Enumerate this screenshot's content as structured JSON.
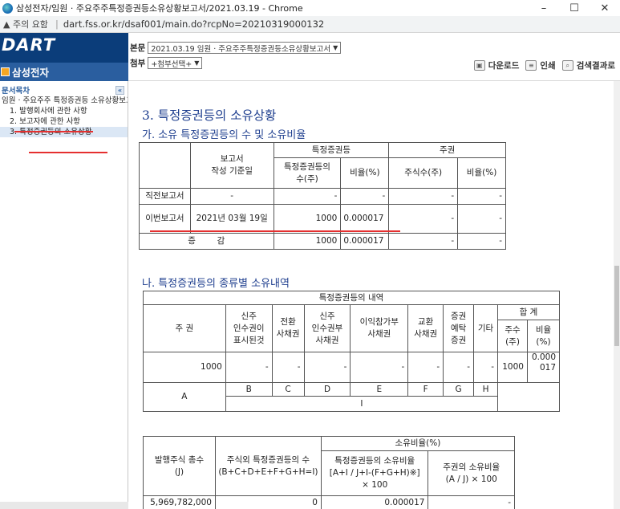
{
  "window": {
    "title": "삼성전자/임원 · 주요주주특정증권등소유상황보고서/2021.03.19 - Chrome",
    "minimize": "–",
    "maximize": "☐",
    "close": "✕"
  },
  "address": {
    "warning": "▲ 주의 요함",
    "url": "dart.fss.or.kr/dsaf001/main.do?rcpNo=20210319000132"
  },
  "header": {
    "logo": "DART",
    "company": "삼성전자",
    "main_label": "본문",
    "main_select": "2021.03.19  임원 · 주요주주특정증권등소유상황보고서",
    "attach_label": "첨부",
    "attach_select": "+첨부선택+",
    "download": "다운로드",
    "print": "인쇄",
    "search_results": "검색결과로"
  },
  "sidebar": {
    "title": "문서목차",
    "collapse": "«",
    "items": [
      {
        "label": "임원 · 주요주주 특정증권등 소유상황보고서"
      },
      {
        "label": "1. 발행회사에 관한 사항"
      },
      {
        "label": "2. 보고자에 관한 사항"
      },
      {
        "label": "3. 특정증권등의 소유상황"
      }
    ]
  },
  "content": {
    "section_title": "3. 특정증권등의 소유상황",
    "sub_a": "가. 소유 특정증권등의 수 및 소유비율",
    "table_a": {
      "h_report_date": "보고서\n작성 기준일",
      "h_specific": "특정증권등",
      "h_shares": "주권",
      "h_spec_count": "특정증권등의\n수(주)",
      "h_ratio": "비율(%)",
      "h_share_count": "주식수(주)",
      "h_ratio2": "비율(%)",
      "rows": [
        {
          "label": "직전보고서",
          "date": "-",
          "count": "-",
          "ratio": "-",
          "shares": "-",
          "ratio2": "-"
        },
        {
          "label": "이번보고서",
          "date": "2021년 03월 19일",
          "count": "1000",
          "ratio": "0.000017",
          "shares": "-",
          "ratio2": "-"
        },
        {
          "label": "증        감",
          "date": "",
          "count": "1000",
          "ratio": "0.000017",
          "shares": "-",
          "ratio2": "-"
        }
      ]
    },
    "sub_b": "나. 특정증권등의 종류별 소유내역",
    "table_b": {
      "h_details": "특정증권등의 내역",
      "h_stock": "주 권",
      "h_warrant": "신주\n인수권이\n표시된것",
      "h_cb": "전환\n사채권",
      "h_bw": "신주\n인수권부\n사채권",
      "h_pb": "이익참가부\n사채권",
      "h_eb": "교환\n사채권",
      "h_dr": "증권\n예탁\n증권",
      "h_etc": "기타",
      "h_total": "합 계",
      "h_total_shares": "주수\n(주)",
      "h_total_ratio": "비율\n(%)",
      "values": [
        "1000",
        "-",
        "-",
        "-",
        "-",
        "-",
        "-",
        "-",
        "1000",
        "0.000017"
      ],
      "letters": [
        "A",
        "B",
        "C",
        "D",
        "E",
        "F",
        "G",
        "H",
        "I"
      ]
    },
    "table_c": {
      "h_ratio": "소유비율(%)",
      "h_total_issued": "발행주식 총수\n(J)",
      "h_excluding": "주식외 특정증권등의 수\n(B+C+D+E+F+G+H=I)",
      "h_spec_ratio": "특정증권등의 소유비율\n[A+I / J+I-(F+G+H)※]\n× 100",
      "h_stock_ratio": "주권의 소유비율\n(A / J) × 100",
      "values": [
        "5,969,782,000",
        "0",
        "0.000017",
        "-"
      ]
    }
  }
}
